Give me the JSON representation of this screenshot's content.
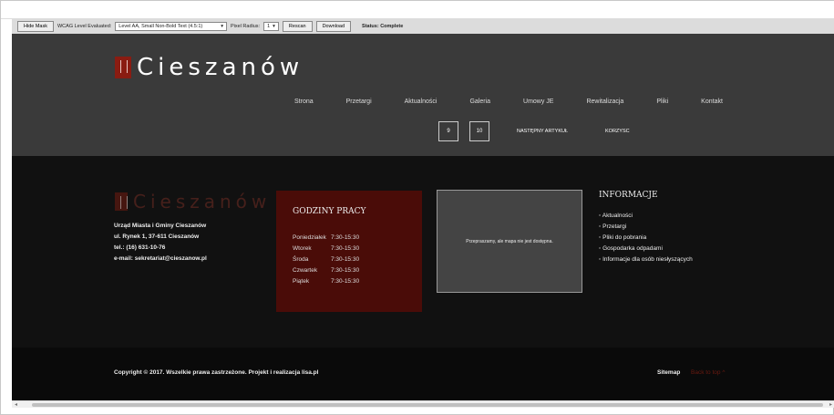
{
  "toolbar": {
    "hide_mask": "Hide Mask",
    "wcag_label": "WCAG Level Evaluated:",
    "wcag_value": "Level AA, Small Non-Bold Text (4.5:1)",
    "pixel_radius_label": "Pixel Radius:",
    "pixel_radius_value": "1",
    "rescan": "Rescan",
    "download": "Download",
    "status": "Status: Complete"
  },
  "header": {
    "logo_text": "Cieszanów",
    "nav": [
      "Strona",
      "Przetargi",
      "Aktualności",
      "Galeria",
      "Umowy JE",
      "Rewitalizacja",
      "Pliki",
      "Kontakt"
    ]
  },
  "pager": {
    "page_a": "9",
    "page_b": "10",
    "next": "NASTĘPNY ARTYKUŁ",
    "prev": "KORZYSC"
  },
  "footer": {
    "logo_text": "Cieszanów",
    "address": [
      "Urząd Miasta i Gminy Cieszanów",
      "ul. Rynek 1, 37-611 Cieszanów",
      "tel.: (16) 631-10-76",
      "e-mail: sekretariat@cieszanow.pl"
    ],
    "hours_title": "GODZINY PRACY",
    "hours": [
      {
        "day": "Poniedziałek",
        "time": "7:30-15:30"
      },
      {
        "day": "Wtorek",
        "time": "7:30-15:30"
      },
      {
        "day": "Środa",
        "time": "7:30-15:30"
      },
      {
        "day": "Czwartek",
        "time": "7:30-15:30"
      },
      {
        "day": "Piątek",
        "time": "7:30-15:30"
      }
    ],
    "map_text": "Przepraszamy, ale mapa nie jest dostępna.",
    "info_title": "INFORMACJE",
    "info_items": [
      "Aktualności",
      "Przetargi",
      "Pliki do pobrania",
      "Gospodarka odpadami",
      "Informacje dla osób niesłyszących"
    ],
    "copyright": "Copyright © 2017. Wszelkie prawa zastrzeżone.  Projekt i realizacja lisa.pl",
    "sitemap": "Sitemap",
    "backtop": "Back to top ^"
  }
}
